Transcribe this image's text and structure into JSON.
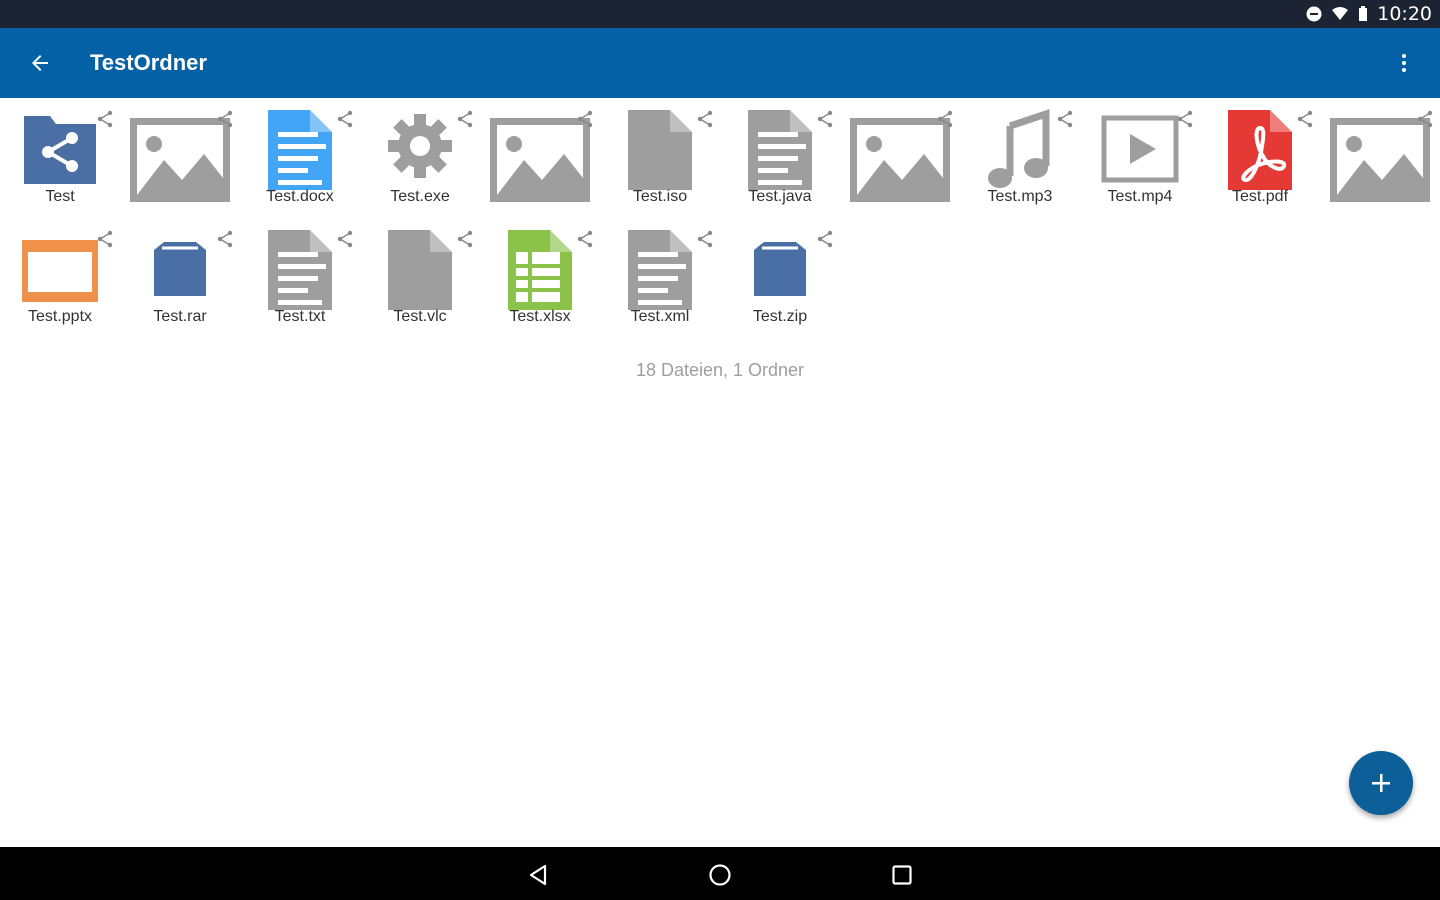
{
  "status_bar": {
    "time": "10:20"
  },
  "app_bar": {
    "title": "TestOrdner"
  },
  "files": [
    {
      "name": "Test",
      "icon": "shared-folder-icon",
      "color": "#4a6fa5"
    },
    {
      "name": "",
      "icon": "image-icon",
      "color": "#9e9e9e"
    },
    {
      "name": "Test.docx",
      "icon": "word-document-icon",
      "color": "#42a5f5"
    },
    {
      "name": "Test.exe",
      "icon": "gear-icon",
      "color": "#9e9e9e"
    },
    {
      "name": "",
      "icon": "image-icon",
      "color": "#9e9e9e"
    },
    {
      "name": "Test.iso",
      "icon": "blank-file-icon",
      "color": "#9e9e9e"
    },
    {
      "name": "Test.java",
      "icon": "text-file-icon",
      "color": "#9e9e9e"
    },
    {
      "name": "",
      "icon": "image-icon",
      "color": "#9e9e9e"
    },
    {
      "name": "Test.mp3",
      "icon": "music-note-icon",
      "color": "#9e9e9e"
    },
    {
      "name": "Test.mp4",
      "icon": "video-icon",
      "color": "#9e9e9e"
    },
    {
      "name": "Test.pdf",
      "icon": "pdf-icon",
      "color": "#e53935"
    },
    {
      "name": "",
      "icon": "image-icon",
      "color": "#9e9e9e"
    },
    {
      "name": "Test.pptx",
      "icon": "presentation-icon",
      "color": "#f0914b"
    },
    {
      "name": "Test.rar",
      "icon": "archive-icon",
      "color": "#4a6fa5"
    },
    {
      "name": "Test.txt",
      "icon": "text-file-icon",
      "color": "#9e9e9e"
    },
    {
      "name": "Test.vlc",
      "icon": "blank-file-icon",
      "color": "#9e9e9e"
    },
    {
      "name": "Test.xlsx",
      "icon": "spreadsheet-icon",
      "color": "#8bc34a"
    },
    {
      "name": "Test.xml",
      "icon": "text-file-icon",
      "color": "#9e9e9e"
    },
    {
      "name": "Test.zip",
      "icon": "archive-icon",
      "color": "#4a6fa5"
    }
  ],
  "summary": "18 Dateien, 1 Ordner",
  "colors": {
    "app_bar": "#0561a6",
    "status_bar": "#1c2434",
    "fab": "#0d5f99",
    "icon_gray": "#9e9e9e"
  }
}
